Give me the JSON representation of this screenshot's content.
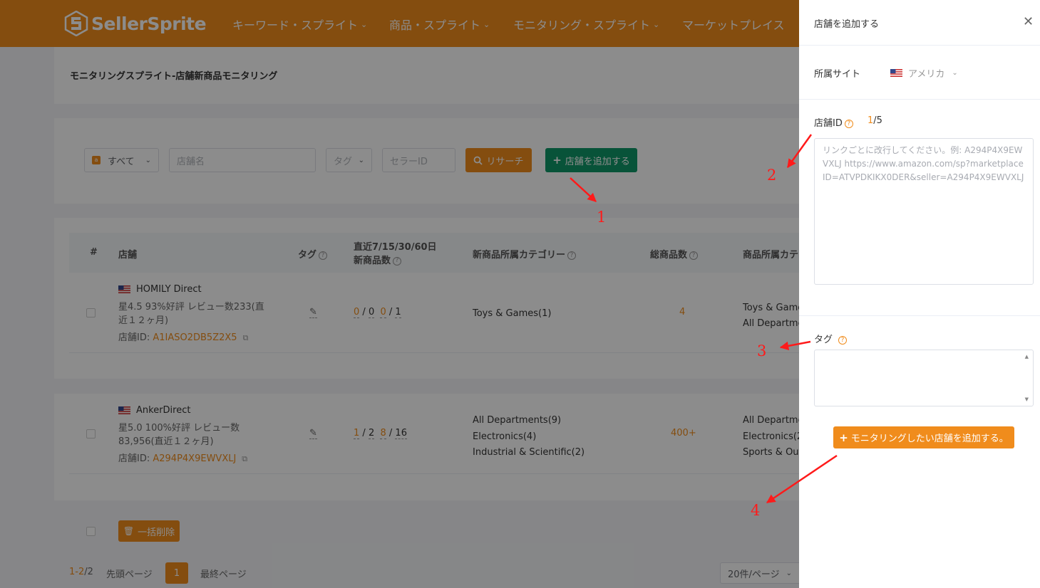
{
  "header": {
    "logo_text": "SellerSprite",
    "nav": [
      {
        "label": "キーワード・スプライト"
      },
      {
        "label": "商品・スプライト"
      },
      {
        "label": "モニタリング・スプライト"
      },
      {
        "label": "マーケットプレイス"
      }
    ]
  },
  "breadcrumb": "モニタリングスプライト-店舗新商品モニタリング",
  "filters": {
    "site_select": "すべて",
    "store_name_placeholder": "店舗名",
    "tag_select": "タグ",
    "seller_id_placeholder": "セラーID",
    "search_button": "リサーチ",
    "add_store_button": "店舗を追加する"
  },
  "table": {
    "headers": {
      "index": "#",
      "store": "店舗",
      "tag": "タグ",
      "recent_line1": "直近7/15/30/60日",
      "recent_line2": "新商品数",
      "new_category": "新商品所属カテゴリー",
      "total": "総商品数",
      "product_category": "商品所属カテ"
    },
    "rows": [
      {
        "name": "HOMILY Direct",
        "rating_line1": "星4.5  93%好評  レビュー数233(直",
        "rating_line2": "近１２ヶ月)",
        "id_label": "店舗ID: ",
        "id_value": "A1IASO2DB5Z2X5",
        "recent_a": "0",
        "recent_b": "0",
        "recent_c": "0",
        "recent_d": "1",
        "new_categories": [
          "Toys & Games(1)"
        ],
        "total": "4",
        "product_categories": [
          "Toys & Game",
          "All Departme"
        ]
      },
      {
        "name": "AnkerDirect",
        "rating_line1": "星5.0  100%好評  レビュー数",
        "rating_line2": "83,956(直近１２ヶ月)",
        "id_label": "店舗ID: ",
        "id_value": "A294P4X9EWVXLJ",
        "recent_a": "1",
        "recent_b": "2",
        "recent_c": "8",
        "recent_d": "16",
        "new_categories": [
          "All Departments(9)",
          "Electronics(4)",
          "Industrial & Scientific(2)"
        ],
        "total": "400+",
        "product_categories": [
          "All Departme",
          "Electronics(2",
          "Sports & Out"
        ]
      }
    ]
  },
  "bulk_delete": "一括削除",
  "pagination": {
    "range_current": "1-2",
    "range_total": "/2",
    "first": "先頭ページ",
    "page": "1",
    "last": "最終ページ",
    "per_page": "20件/ページ"
  },
  "drawer": {
    "title": "店舗を追加する",
    "site_label": "所属サイト",
    "site_value": "アメリカ",
    "store_id_label": "店舗ID",
    "count_current": "1",
    "count_total": "/5",
    "textarea_placeholder": "リンクごとに改行してください。例: A294P4X9EWVXLJ https://www.amazon.com/sp?marketplaceID=ATVPDKIKX0DER&seller=A294P4X9EWVXLJ",
    "tag_label": "タグ",
    "submit_button": "モニタリングしたい店舗を追加する。"
  },
  "annotations": [
    "1",
    "2",
    "3",
    "4"
  ],
  "colors": {
    "brand_orange": "#f08c1c",
    "green": "#109868",
    "annotation_red": "#ff1a1a"
  }
}
